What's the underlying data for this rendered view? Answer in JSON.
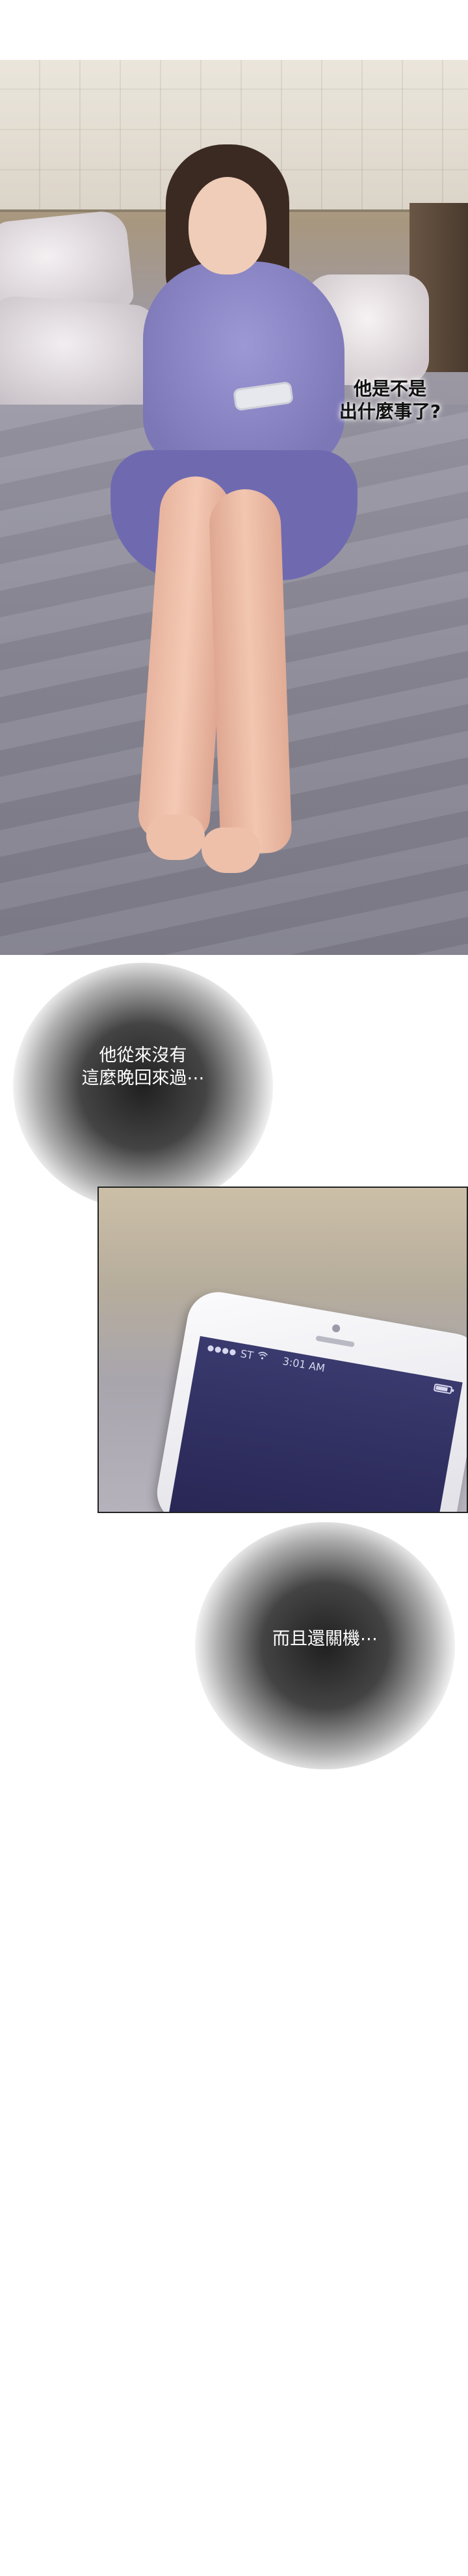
{
  "panel1": {
    "caption": "他是不是\n出什麼事了?"
  },
  "thoughts": [
    {
      "text": "他從來沒有\n這麼晚回來過⋯"
    },
    {
      "text": "而且還關機⋯"
    }
  ],
  "phone": {
    "carrier": "ST",
    "signal_icon": "signal-dots-icon",
    "wifi_icon": "wifi-icon",
    "time": "3:01 AM",
    "battery_icon": "battery-icon",
    "battery_level": 0.8
  },
  "colors": {
    "shirt": "#8d88c8",
    "sheet": "#8a8895",
    "phone_screen": "#2e2d5e",
    "thought_blob": "#1e1e1e"
  }
}
